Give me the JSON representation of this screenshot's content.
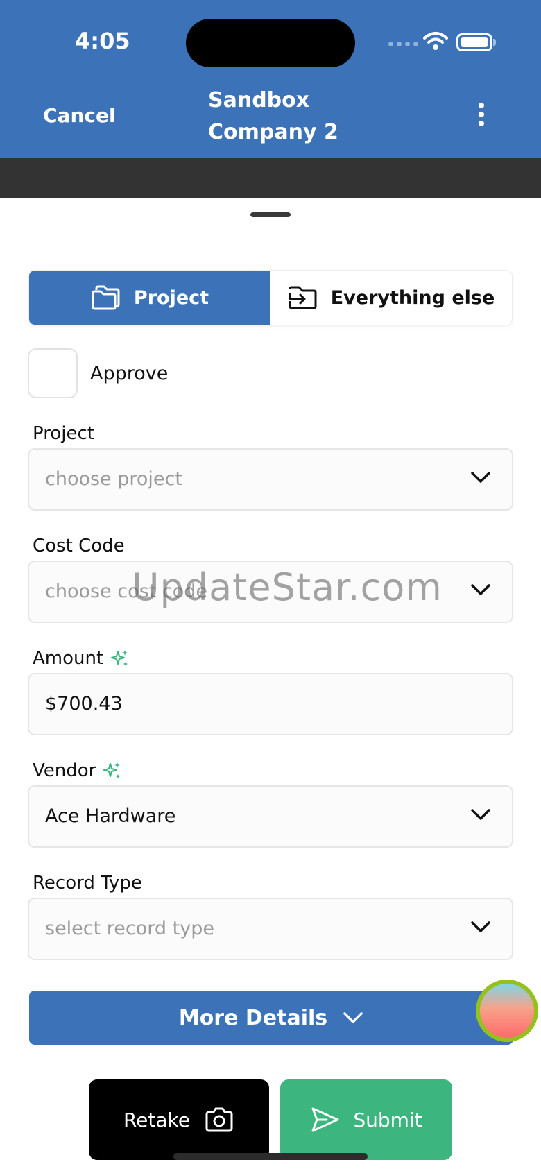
{
  "status_bar": {
    "time": "4:05"
  },
  "header": {
    "cancel_label": "Cancel",
    "title_line1": "Sandbox",
    "title_line2": "Company 2"
  },
  "tabs": [
    {
      "label": "Project",
      "icon": "folder-icon",
      "active": true
    },
    {
      "label": "Everything else",
      "icon": "folder-arrow-icon",
      "active": false
    }
  ],
  "approve": {
    "label": "Approve",
    "checked": false
  },
  "fields": {
    "project": {
      "label": "Project",
      "placeholder": "choose project"
    },
    "cost_code": {
      "label": "Cost Code",
      "placeholder": "choose cost code"
    },
    "amount": {
      "label": "Amount",
      "value": "$700.43",
      "ai_icon": "sparkle-icon"
    },
    "vendor": {
      "label": "Vendor",
      "value": "Ace Hardware",
      "ai_icon": "sparkle-icon"
    },
    "record_type": {
      "label": "Record Type",
      "placeholder": "select record type"
    }
  },
  "watermark": "UpdateStar.com",
  "more_details_label": "More Details",
  "actions": {
    "retake_label": "Retake",
    "submit_label": "Submit"
  },
  "colors": {
    "brand_blue": "#3c73b8",
    "submit_green": "#3cb57f",
    "sparkle_green": "#3cb57f"
  }
}
